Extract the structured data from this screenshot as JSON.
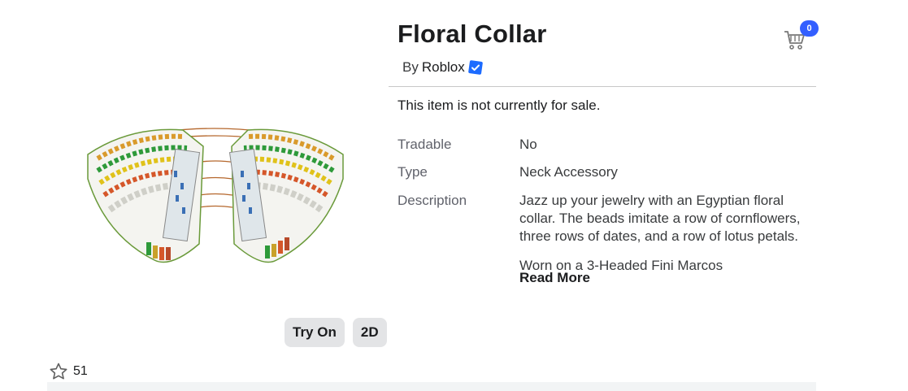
{
  "item": {
    "title": "Floral Collar",
    "by_prefix": "By",
    "creator": "Roblox",
    "sale_note": "This item is not currently for sale."
  },
  "cart": {
    "count": "0",
    "icon": "cart-icon"
  },
  "details": {
    "tradable_label": "Tradable",
    "tradable_value": "No",
    "type_label": "Type",
    "type_value": "Neck Accessory",
    "description_label": "Description",
    "description_p1": "Jazz up your jewelry with an Egyptian floral collar. The beads imitate a row of cornflowers, three rows of dates, and a row of lotus petals.",
    "description_p2": "Worn on a 3-Headed Fini Marcos",
    "read_more": "Read More"
  },
  "actions": {
    "try_on": "Try On",
    "view_2d": "2D"
  },
  "favorites": {
    "count": "51",
    "icon": "star-icon"
  },
  "colors": {
    "accent": "#335fff",
    "button_bg": "#e3e4e6"
  }
}
